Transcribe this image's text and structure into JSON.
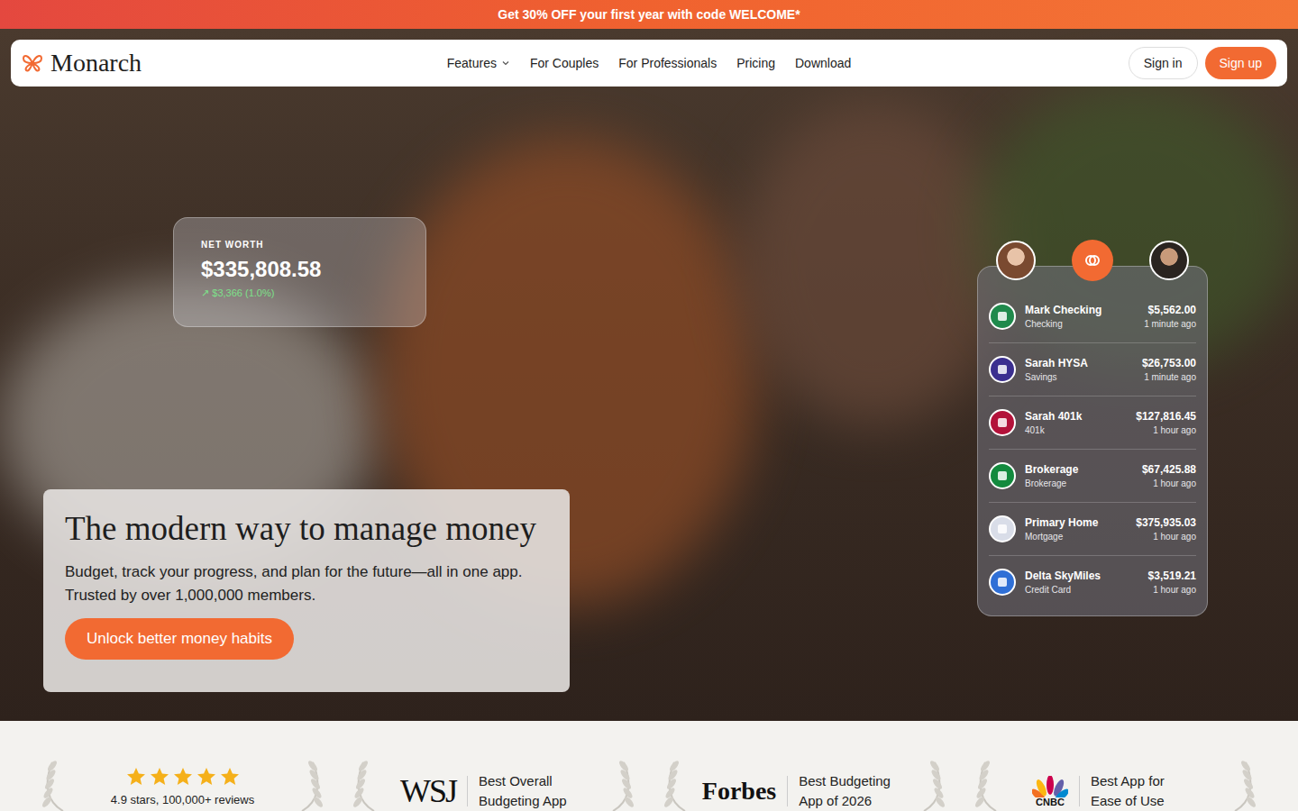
{
  "promo": {
    "text": "Get 30% OFF your first year with code WELCOME*"
  },
  "nav": {
    "logo": "Monarch",
    "items": [
      {
        "label": "Features",
        "has_menu": true
      },
      {
        "label": "For Couples",
        "has_menu": false
      },
      {
        "label": "For Professionals",
        "has_menu": false
      },
      {
        "label": "Pricing",
        "has_menu": false
      },
      {
        "label": "Download",
        "has_menu": false
      }
    ],
    "sign_in": "Sign in",
    "sign_up": "Sign up"
  },
  "hero": {
    "title": "The modern way to manage money",
    "subtitle": "Budget, track your progress, and plan for the future—all in one app. Trusted by over 1,000,000 members.",
    "cta": "Unlock better money habits"
  },
  "net_worth": {
    "label": "NET WORTH",
    "value": "$335,808.58",
    "change": "↗ $3,366 (1.0%)"
  },
  "accounts": [
    {
      "name": "Mark Checking",
      "type": "Checking",
      "amount": "$5,562.00",
      "updated": "1 minute ago",
      "color": "#1f8a4c"
    },
    {
      "name": "Sarah HYSA",
      "type": "Savings",
      "amount": "$26,753.00",
      "updated": "1 minute ago",
      "color": "#3b2f8f"
    },
    {
      "name": "Sarah 401k",
      "type": "401k",
      "amount": "$127,816.45",
      "updated": "1 hour ago",
      "color": "#b3123a"
    },
    {
      "name": "Brokerage",
      "type": "Brokerage",
      "amount": "$67,425.88",
      "updated": "1 hour ago",
      "color": "#138a3e"
    },
    {
      "name": "Primary Home",
      "type": "Mortgage",
      "amount": "$375,935.03",
      "updated": "1 hour ago",
      "color": "#d9dde8"
    },
    {
      "name": "Delta SkyMiles",
      "type": "Credit Card",
      "amount": "$3,519.21",
      "updated": "1 hour ago",
      "color": "#2f6fd6"
    }
  ],
  "awards": [
    {
      "kind": "rating",
      "stars": 5,
      "text": "4.9 stars, 100,000+ reviews"
    },
    {
      "kind": "press",
      "source": "WSJ",
      "text": "Best Overall Budgeting App"
    },
    {
      "kind": "press",
      "source": "Forbes",
      "text": "Best Budgeting App of 2026"
    },
    {
      "kind": "press",
      "source": "CNBC",
      "text": "Best App for Ease of Use"
    }
  ]
}
